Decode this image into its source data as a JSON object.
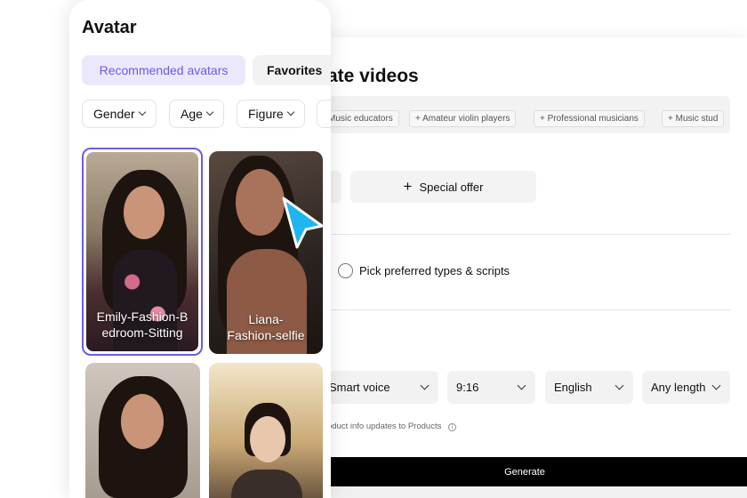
{
  "main": {
    "title": "Create videos",
    "title_visible": "ate videos",
    "audience_tags": [
      "Music educators",
      "Amateur violin players",
      "Professional musicians",
      "Music stud"
    ],
    "special_offer": "Special offer",
    "pick_option": "Pick preferred types & scripts",
    "selects": [
      {
        "label": "Smart voice"
      },
      {
        "label": "9:16"
      },
      {
        "label": "English"
      },
      {
        "label": "Any length"
      }
    ],
    "note": "oduct info updates to Products",
    "generate": "Generate"
  },
  "avatar_panel": {
    "title": "Avatar",
    "tabs": [
      {
        "label": "Recommended avatars",
        "active": true
      },
      {
        "label": "Favorites",
        "active": false
      }
    ],
    "filters": [
      "Gender",
      "Age",
      "Figure"
    ],
    "avatars": [
      {
        "name": "Emily-Fashion-Bedroom-Sitting",
        "selected": true
      },
      {
        "name": "Liana-Fashion-selfie",
        "selected": false
      },
      {
        "name": "",
        "selected": false
      },
      {
        "name": "",
        "selected": false
      }
    ]
  },
  "colors": {
    "accent": "#6b5ce7",
    "tab_active_bg": "#ebe8fc",
    "cursor": "#1fb6f0"
  }
}
